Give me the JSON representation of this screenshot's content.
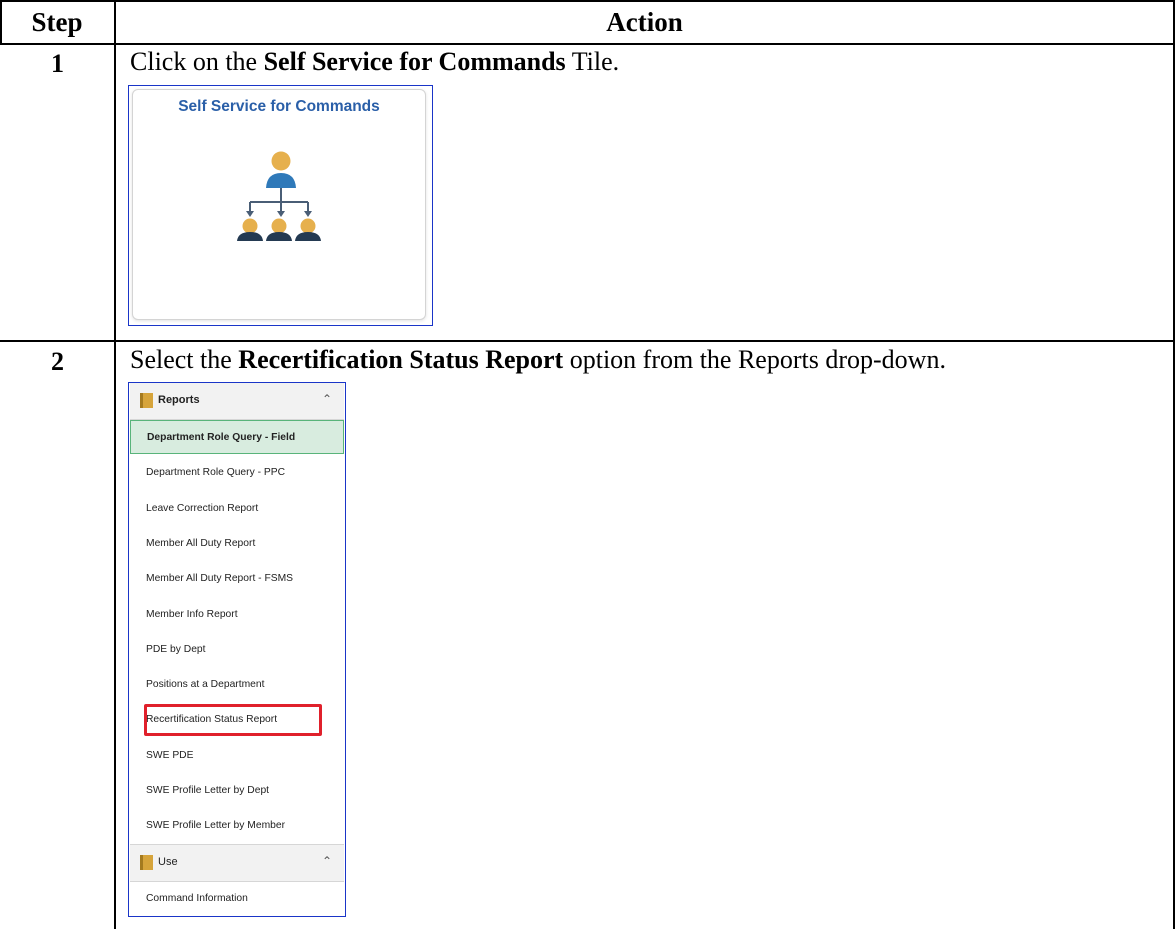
{
  "table": {
    "headers": {
      "step": "Step",
      "action": "Action"
    },
    "rows": [
      {
        "step": "1",
        "instruction_pre": "Click on the ",
        "instruction_bold": "Self Service for Commands",
        "instruction_post": " Tile.",
        "tile": {
          "title": "Self Service for Commands",
          "icon": "org-chart-icon"
        }
      },
      {
        "step": "2",
        "instruction_pre": "Select the ",
        "instruction_bold": "Recertification Status Report",
        "instruction_post": " option from the Reports drop-down."
      }
    ]
  },
  "nav": {
    "sections": [
      {
        "label": "Reports",
        "icon": "folder-icon",
        "toggle_icon": "chevron-up-icon"
      },
      {
        "label": "Use",
        "icon": "folder-icon",
        "toggle_icon": "chevron-up-icon"
      }
    ],
    "report_items": [
      "Department Role Query - Field",
      "Department Role Query - PPC",
      "Leave Correction Report",
      "Member All Duty Report",
      "Member All Duty Report - FSMS",
      "Member Info Report",
      "PDE by Dept",
      "Positions at a Department",
      "Recertification Status Report",
      "SWE PDE",
      "SWE Profile Letter by Dept",
      "SWE Profile Letter by Member"
    ],
    "use_items": [
      "Command Information"
    ],
    "active_item": "Department Role Query - Field",
    "highlighted_item": "Recertification Status Report"
  },
  "colors": {
    "tile_title": "#2a5fa8",
    "active_bg": "#d8ecdf",
    "highlight": "#e0202b",
    "frame": "#1a35c8"
  }
}
